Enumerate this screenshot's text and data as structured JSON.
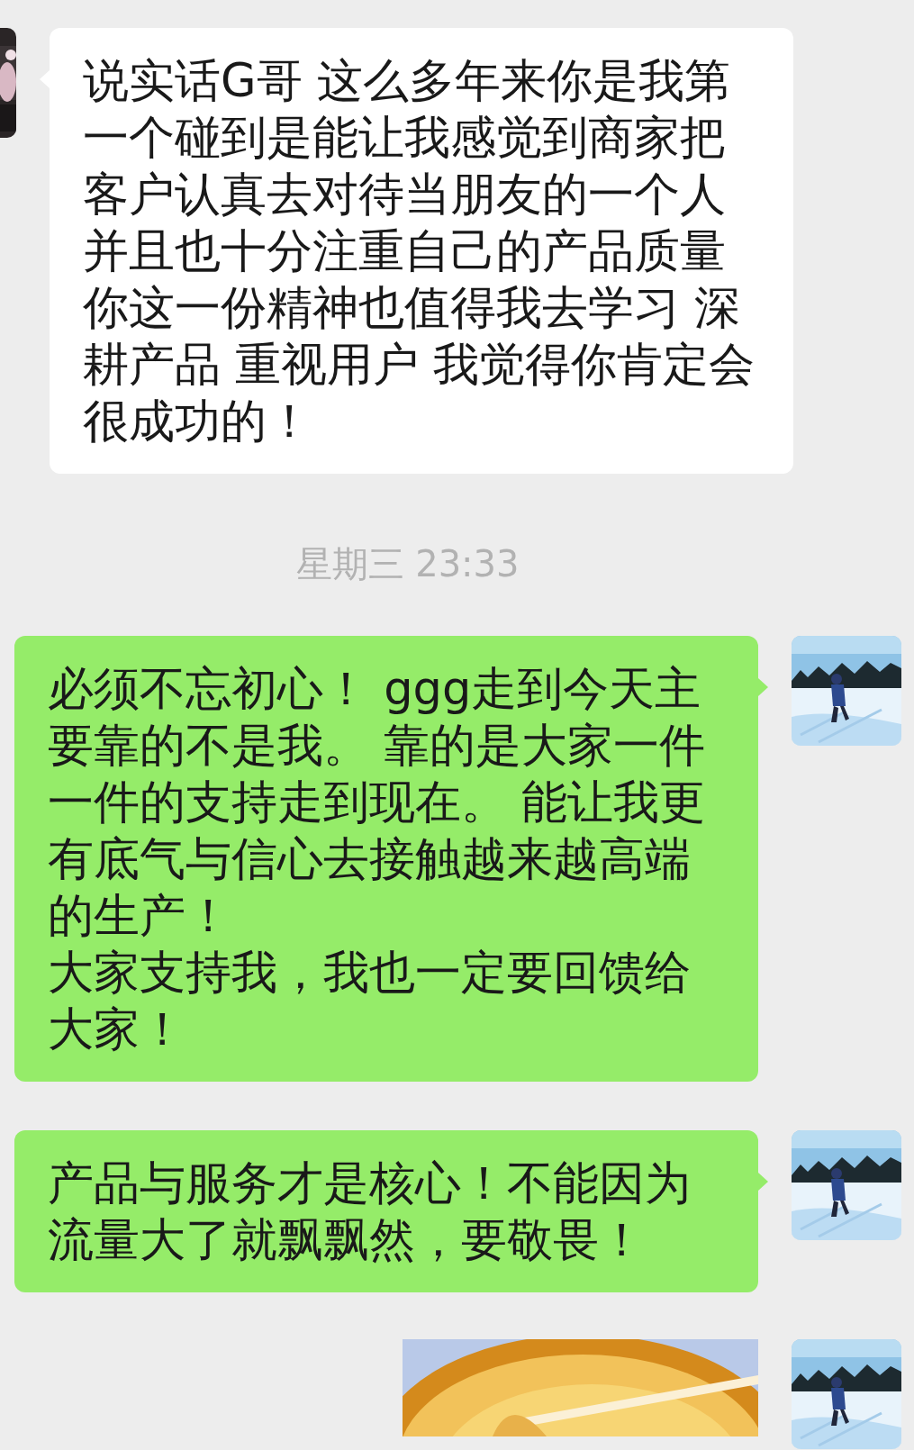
{
  "messages": [
    {
      "kind": "received",
      "paragraphs": [
        "说实话G哥 这么多年来你是我第一个碰到是能让我感觉到商家把客户认真去对待当朋友的一个人并且也十分注重自己的产品质量你这一份精神也值得我去学习 深耕产品 重视用户 我觉得你肯定会很成功的！"
      ]
    },
    {
      "kind": "time",
      "text": "星期三 23:33"
    },
    {
      "kind": "sent",
      "paragraphs": [
        "必须不忘初心！ ggg走到今天主要靠的不是我。 靠的是大家一件一件的支持走到现在。 能让我更有底气与信心去接触越来越高端的生产！",
        "大家支持我，我也一定要回馈给大家！"
      ]
    },
    {
      "kind": "sent",
      "paragraphs": [
        "产品与服务才是核心！不能因为流量大了就飘飘然，要敬畏！"
      ]
    },
    {
      "kind": "sent_picture"
    }
  ]
}
